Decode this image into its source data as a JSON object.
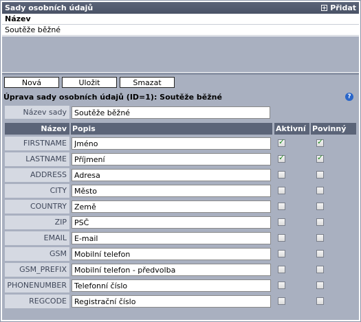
{
  "list_panel": {
    "title": "Sady osobních údajů",
    "add_label": "Přidat",
    "column_header": "Název",
    "rows": [
      "Soutěže běžné"
    ]
  },
  "toolbar": {
    "new_label": "Nová",
    "save_label": "Uložit",
    "delete_label": "Smazat"
  },
  "edit_panel": {
    "title": "Úprava sady osobních údajů (ID=1): Soutěže běžné",
    "name_label": "Název sady",
    "name_value": "Soutěže běžné",
    "headers": {
      "name": "Název",
      "description": "Popis",
      "active": "Aktivní",
      "required": "Povinný"
    },
    "fields": [
      {
        "code": "FIRSTNAME",
        "description": "Jméno",
        "active": true,
        "required": true
      },
      {
        "code": "LASTNAME",
        "description": "Příjmení",
        "active": true,
        "required": true
      },
      {
        "code": "ADDRESS",
        "description": "Adresa",
        "active": false,
        "required": false
      },
      {
        "code": "CITY",
        "description": "Město",
        "active": false,
        "required": false
      },
      {
        "code": "COUNTRY",
        "description": "Země",
        "active": false,
        "required": false
      },
      {
        "code": "ZIP",
        "description": "PSČ",
        "active": false,
        "required": false
      },
      {
        "code": "EMAIL",
        "description": "E-mail",
        "active": false,
        "required": false
      },
      {
        "code": "GSM",
        "description": "Mobilní telefon",
        "active": false,
        "required": false
      },
      {
        "code": "GSM_PREFIX",
        "description": "Mobilní telefon - předvolba",
        "active": false,
        "required": false
      },
      {
        "code": "PHONENUMBER",
        "description": "Telefonní číslo",
        "active": false,
        "required": false
      },
      {
        "code": "REGCODE",
        "description": "Registrační číslo",
        "active": false,
        "required": false
      }
    ]
  },
  "colors": {
    "header_bg": "#5b6478",
    "panel_bg": "#a9b0c0",
    "label_bg": "#d5d9e2",
    "check_green": "#1f8a1f"
  }
}
